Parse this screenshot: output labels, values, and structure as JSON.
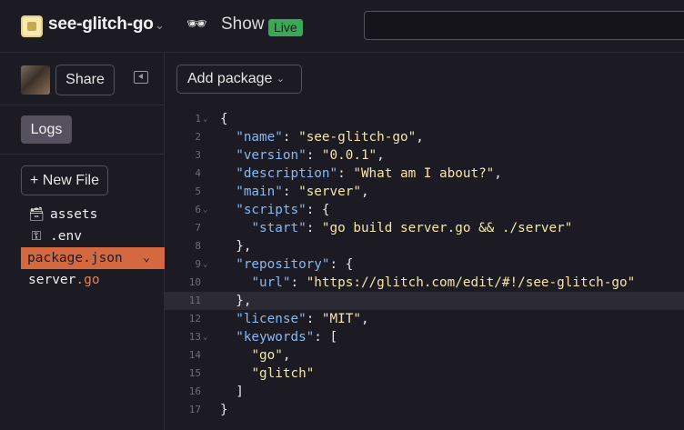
{
  "header": {
    "project_name": "see-glitch-go",
    "show_icon": "🕶",
    "show_label": "Show",
    "live_badge": "Live",
    "search_placeholder": ""
  },
  "sidebar": {
    "share_label": "Share",
    "logs_label": "Logs",
    "new_file_label": "+ New File",
    "files": [
      {
        "icon": "folder-icon",
        "name": "assets",
        "ext": ""
      },
      {
        "icon": "key-icon",
        "name": ".env",
        "ext": ""
      },
      {
        "icon": "",
        "name": "package.json",
        "ext": "",
        "active": true
      },
      {
        "icon": "",
        "name": "server",
        "ext": ".go"
      }
    ]
  },
  "editor": {
    "add_package_label": "Add package",
    "highlighted_line": 11,
    "lines": [
      {
        "n": "1",
        "fold": true,
        "text": "{"
      },
      {
        "n": "2",
        "fold": false,
        "text": "  \"name\": \"see-glitch-go\","
      },
      {
        "n": "3",
        "fold": false,
        "text": "  \"version\": \"0.0.1\","
      },
      {
        "n": "4",
        "fold": false,
        "text": "  \"description\": \"What am I about?\","
      },
      {
        "n": "5",
        "fold": false,
        "text": "  \"main\": \"server\","
      },
      {
        "n": "6",
        "fold": true,
        "text": "  \"scripts\": {"
      },
      {
        "n": "7",
        "fold": false,
        "text": "    \"start\": \"go build server.go && ./server\""
      },
      {
        "n": "8",
        "fold": false,
        "text": "  },"
      },
      {
        "n": "9",
        "fold": true,
        "text": "  \"repository\": {"
      },
      {
        "n": "10",
        "fold": false,
        "text": "    \"url\": \"https://glitch.com/edit/#!/see-glitch-go\""
      },
      {
        "n": "11",
        "fold": false,
        "text": "  },"
      },
      {
        "n": "12",
        "fold": false,
        "text": "  \"license\": \"MIT\","
      },
      {
        "n": "13",
        "fold": true,
        "text": "  \"keywords\": ["
      },
      {
        "n": "14",
        "fold": false,
        "text": "    \"go\","
      },
      {
        "n": "15",
        "fold": false,
        "text": "    \"glitch\""
      },
      {
        "n": "16",
        "fold": false,
        "text": "  ]"
      },
      {
        "n": "17",
        "fold": false,
        "text": "}"
      }
    ]
  }
}
